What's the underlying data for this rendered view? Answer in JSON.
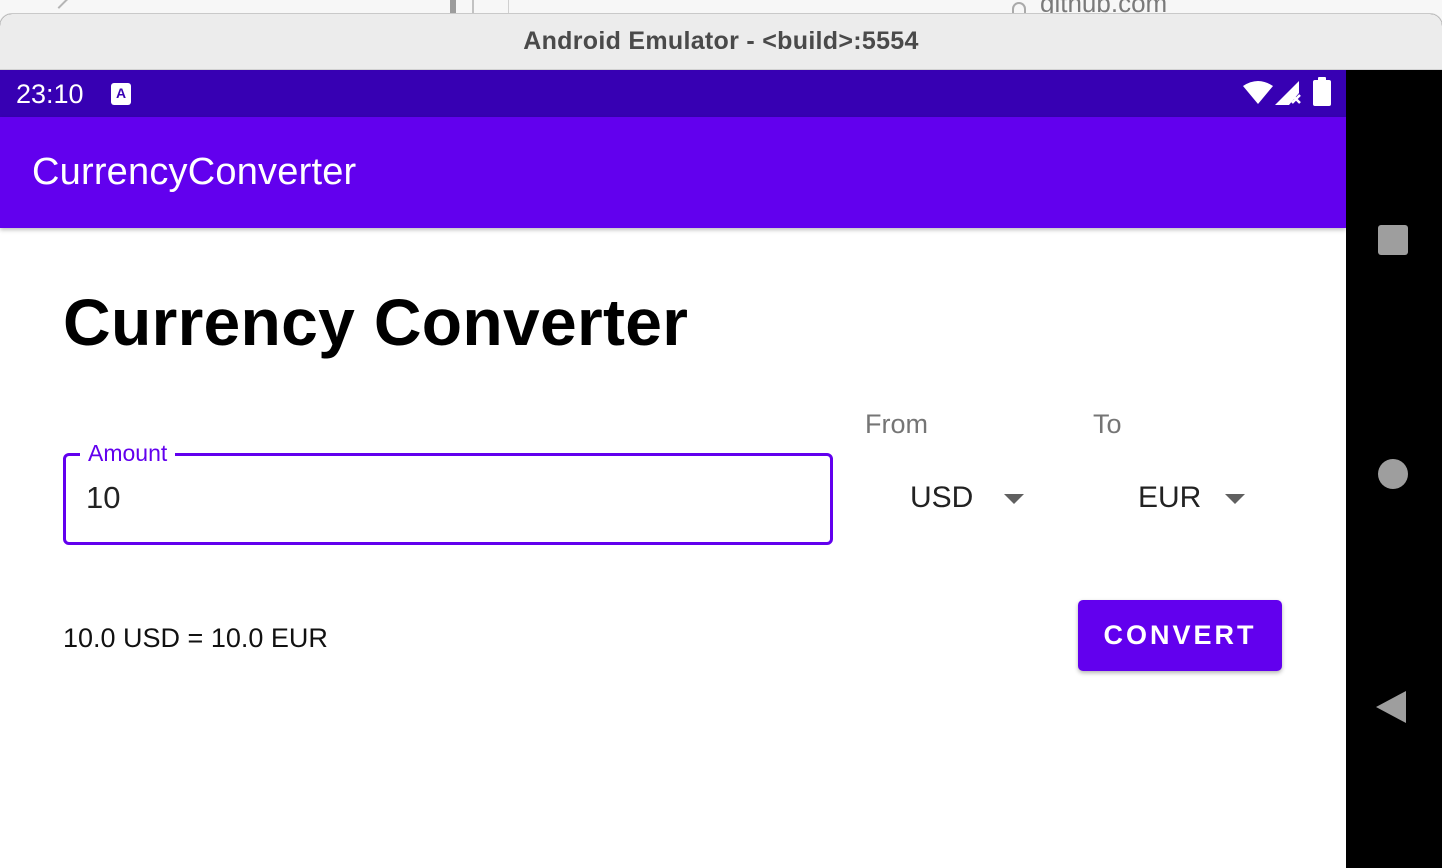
{
  "background_browser": {
    "url": "github.com"
  },
  "window": {
    "title": "Android Emulator - <build>:5554"
  },
  "status_bar": {
    "time": "23:10",
    "notification_icon": "accessibility-notification-icon",
    "notification_letter": "A",
    "icons": [
      "wifi-icon",
      "signal-icon",
      "battery-icon"
    ],
    "color": "#3700b3"
  },
  "app_bar": {
    "title": "CurrencyConverter",
    "color": "#6200ee"
  },
  "main": {
    "heading": "Currency Converter",
    "amount": {
      "label": "Amount",
      "value": "10"
    },
    "from": {
      "label": "From",
      "selected": "USD"
    },
    "to": {
      "label": "To",
      "selected": "EUR"
    },
    "result": "10.0 USD = 10.0 EUR",
    "convert_label": "CONVERT"
  },
  "nav_bar": {
    "buttons": [
      "recents-icon",
      "home-icon",
      "back-icon"
    ]
  },
  "colors": {
    "accent": "#6200ee",
    "status_bar": "#3700b3"
  }
}
